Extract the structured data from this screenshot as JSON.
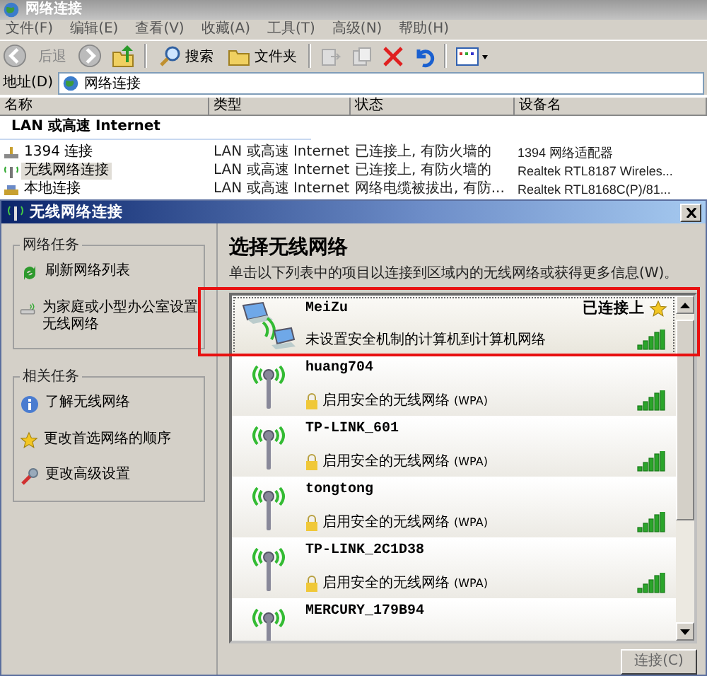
{
  "explorer": {
    "title": "网络连接",
    "menu": [
      "文件(F)",
      "编辑(E)",
      "查看(V)",
      "收藏(A)",
      "工具(T)",
      "高级(N)",
      "帮助(H)"
    ],
    "toolbar": {
      "back": "后退",
      "search": "搜索",
      "folders": "文件夹"
    },
    "address": {
      "label": "地址(D)",
      "value": "网络连接"
    },
    "columns": [
      "名称",
      "类型",
      "状态",
      "设备名"
    ],
    "group": "LAN 或高速 Internet",
    "rows": [
      {
        "kind": "firewire",
        "name": "1394 连接",
        "type": "LAN 或高速 Internet",
        "status": "已连接上, 有防火墙的",
        "device": "1394 网络适配器",
        "selected": false
      },
      {
        "kind": "wireless",
        "name": "无线网络连接",
        "type": "LAN 或高速 Internet",
        "status": "已连接上, 有防火墙的",
        "device": "Realtek RTL8187 Wireles...",
        "selected": true
      },
      {
        "kind": "lan",
        "name": "本地连接",
        "type": "LAN 或高速 Internet",
        "status": "网络电缆被拔出, 有防...",
        "device": "Realtek RTL8168C(P)/81...",
        "selected": false
      }
    ]
  },
  "dialog": {
    "title": "无线网络连接",
    "task_groups": [
      {
        "title": "网络任务",
        "items": [
          {
            "kind": "refresh",
            "label": "刷新网络列表"
          },
          {
            "kind": "setup",
            "label": "为家庭或小型办公室设置无线网络"
          }
        ]
      },
      {
        "title": "相关任务",
        "items": [
          {
            "kind": "info",
            "label": "了解无线网络"
          },
          {
            "kind": "star",
            "label": "更改首选网络的顺序"
          },
          {
            "kind": "tools",
            "label": "更改高级设置"
          }
        ]
      }
    ],
    "heading": "选择无线网络",
    "instruction": "单击以下列表中的项目以连接到区域内的无线网络或获得更多信息(W)。",
    "networks": [
      {
        "kind": "adhoc",
        "name": "MeiZu",
        "status": "已连接上",
        "security": "未设置安全机制的计算机到计算机网络",
        "secured": false,
        "connected": true,
        "selected": true,
        "highlighted": true
      },
      {
        "kind": "access_point",
        "name": "huang704",
        "security": "启用安全的无线网络",
        "security_type": "(WPA)",
        "secured": true,
        "connected": false,
        "selected": false,
        "highlighted": false
      },
      {
        "kind": "access_point",
        "name": "TP-LINK_601",
        "security": "启用安全的无线网络",
        "security_type": "(WPA)",
        "secured": true,
        "connected": false,
        "selected": false,
        "highlighted": false
      },
      {
        "kind": "access_point",
        "name": "tongtong",
        "security": "启用安全的无线网络",
        "security_type": "(WPA)",
        "secured": true,
        "connected": false,
        "selected": false,
        "highlighted": false
      },
      {
        "kind": "access_point",
        "name": "TP-LINK_2C1D38",
        "security": "启用安全的无线网络",
        "security_type": "(WPA)",
        "secured": true,
        "connected": false,
        "selected": false,
        "highlighted": false
      },
      {
        "kind": "access_point",
        "name": "MERCURY_179B94",
        "connected": false,
        "selected": false,
        "highlighted": false
      }
    ],
    "connect_button": "连接(C)"
  }
}
